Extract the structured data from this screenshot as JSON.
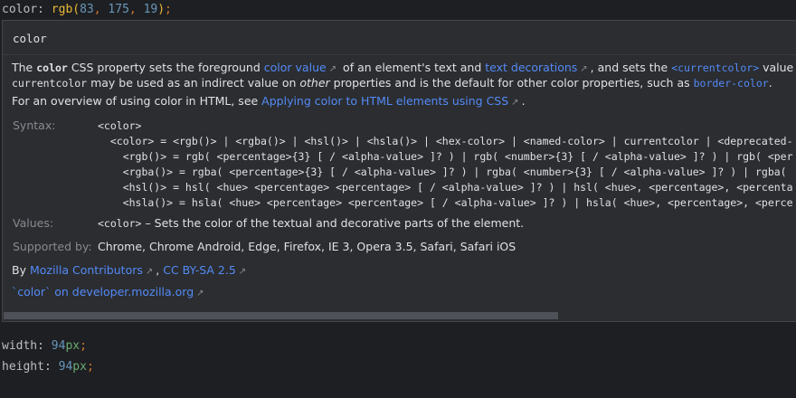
{
  "editor": {
    "line1": {
      "prop": "color",
      "colon": ": ",
      "fn": "rgb",
      "open": "(",
      "r": "83",
      "sep1": ", ",
      "g": "175",
      "sep2": ", ",
      "b": "19",
      "close": ")",
      "semi": ";"
    },
    "line2": {
      "prop": "width",
      "colon": ": ",
      "num": "94",
      "unit": "px",
      "semi": ";"
    },
    "line3": {
      "prop": "height",
      "colon": ": ",
      "num": "94",
      "unit": "px",
      "semi": ";"
    }
  },
  "popup": {
    "title": "color",
    "desc": {
      "t1": "The ",
      "code1": "color",
      "t2": " CSS property sets the foreground ",
      "link1": "color value",
      "t3": " of an element's text and ",
      "link2": "text decorations",
      "t4": ", and sets the ",
      "link3": "<currentcolor>",
      "t5": " value",
      "code2": "currentcolor",
      "t6": " may be used as an indirect value on ",
      "em": "other",
      "t7": " properties and is the default for other color properties, such as ",
      "link4": "border-color",
      "t8": ".",
      "t9": "For an overview of using color in HTML, see ",
      "link5": "Applying color to HTML elements using CSS",
      "t10": "."
    },
    "syntax_label": "Syntax:",
    "syntax_lines": [
      "<color>",
      "  <color> = <rgb()> | <rgba()> | <hsl()> | <hsla()> | <hex-color> | <named-color> | currentcolor | <deprecated-",
      "    <rgb()> = rgb( <percentage>{3} [ / <alpha-value> ]? ) | rgb( <number>{3} [ / <alpha-value> ]? ) | rgb( <per",
      "    <rgba()> = rgba( <percentage>{3} [ / <alpha-value> ]? ) | rgba( <number>{3} [ / <alpha-value> ]? ) | rgba(",
      "    <hsl()> = hsl( <hue> <percentage> <percentage> [ / <alpha-value> ]? ) | hsl( <hue>, <percentage>, <percenta",
      "    <hsla()> = hsla( <hue> <percentage> <percentage> [ / <alpha-value> ]? ) | hsla( <hue>, <percentage>, <perce"
    ],
    "values_label": "Values:",
    "values_code": "<color>",
    "values_text": " – Sets the color of the textual and decorative parts of the element.",
    "supported_label": "Supported by:",
    "supported_text": "Chrome, Chrome Android, Edge, Firefox, IE 3, Opera 3.5, Safari, Safari iOS",
    "by": "By ",
    "contributors": "Mozilla Contributors",
    "comma": ", ",
    "license": "CC BY-SA 2.5",
    "mdn_link": "`color` on developer.mozilla.org",
    "arrow": "↗"
  }
}
